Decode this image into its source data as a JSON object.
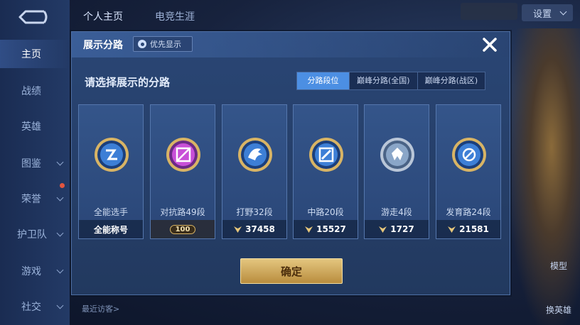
{
  "top_tabs": [
    "个人主页",
    "电竞生涯"
  ],
  "settings_label": "设置",
  "nav": [
    {
      "label": "主页",
      "active": true
    },
    {
      "label": "战绩"
    },
    {
      "label": "英雄"
    },
    {
      "label": "图鉴"
    },
    {
      "label": "荣誉"
    },
    {
      "label": "护卫队"
    },
    {
      "label": "游戏"
    },
    {
      "label": "社交"
    }
  ],
  "visitors_label": "最近访客>",
  "side_buttons": [
    "模型",
    "换英雄"
  ],
  "modal": {
    "title": "展示分路",
    "pref_button": "优先显示",
    "subtitle": "请选择展示的分路",
    "segments": [
      {
        "label": "分路段位",
        "active": true
      },
      {
        "label": "巅峰分路(全国)"
      },
      {
        "label": "巅峰分路(战区)"
      }
    ],
    "cards": [
      {
        "name": "全能选手",
        "footer": "全能称号",
        "badge_color": "#3d7fd6",
        "icon": "allround-icon"
      },
      {
        "name": "对抗路49段",
        "footer": "100",
        "badge_color": "#c84fd8",
        "icon": "sword-icon"
      },
      {
        "name": "打野32段",
        "footer": "37458",
        "badge_color": "#3d7fd6",
        "icon": "wolf-icon"
      },
      {
        "name": "中路20段",
        "footer": "15527",
        "badge_color": "#3d7fd6",
        "icon": "staff-icon"
      },
      {
        "name": "游走4段",
        "footer": "1727",
        "badge_color": "#8aa6c8",
        "icon": "wing-icon"
      },
      {
        "name": "发育路24段",
        "footer": "21581",
        "badge_color": "#3d7fd6",
        "icon": "target-icon"
      }
    ],
    "confirm_label": "确定"
  },
  "colors": {
    "accent": "#4c8fe3",
    "confirm_gold": "#d7b46a",
    "modal_bg": "#2a4675"
  }
}
